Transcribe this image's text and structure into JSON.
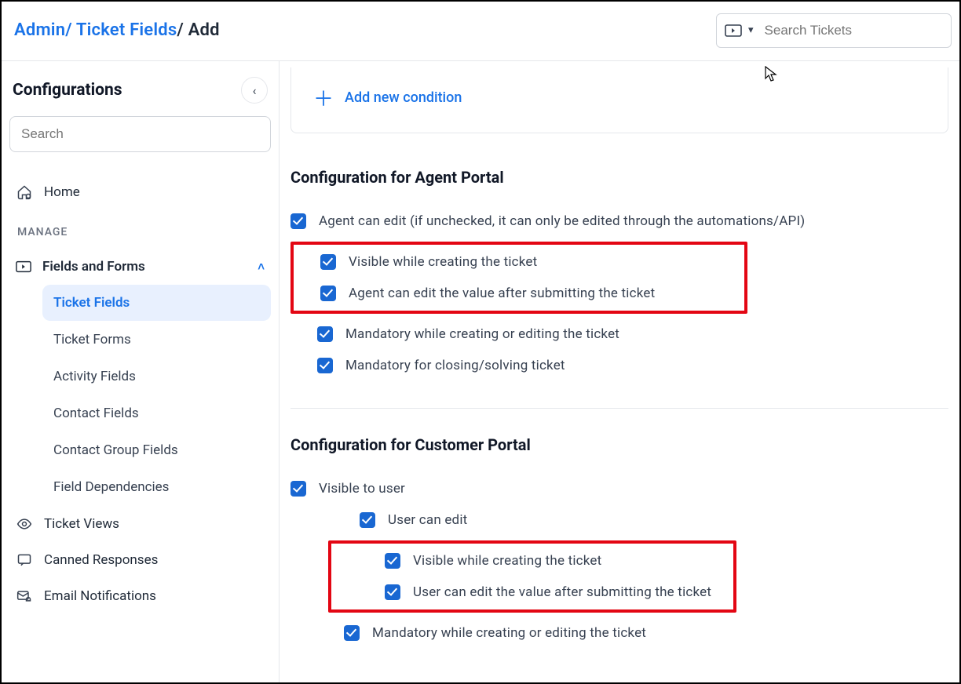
{
  "breadcrumb": {
    "admin": "Admin",
    "ticket_fields": "Ticket Fields",
    "add": "Add"
  },
  "search_tickets": {
    "placeholder": "Search Tickets"
  },
  "sidebar": {
    "title": "Configurations",
    "search_placeholder": "Search",
    "home": "Home",
    "manage_label": "MANAGE",
    "fields_and_forms": "Fields and Forms",
    "children": {
      "ticket_fields": "Ticket Fields",
      "ticket_forms": "Ticket Forms",
      "activity_fields": "Activity Fields",
      "contact_fields": "Contact Fields",
      "contact_group_fields": "Contact Group Fields",
      "field_dependencies": "Field Dependencies"
    },
    "ticket_views": "Ticket Views",
    "canned_responses": "Canned Responses",
    "email_notifications": "Email Notifications"
  },
  "main": {
    "add_condition": "Add new condition",
    "agent_header": "Configuration for Agent Portal",
    "agent": {
      "can_edit": "Agent can edit (if unchecked, it can only be edited through the automations/API)",
      "visible_creating": "Visible while creating the ticket",
      "agent_edit_after": "Agent can edit the value after submitting the ticket",
      "mandatory_create_edit": "Mandatory while creating or editing the ticket",
      "mandatory_closing": "Mandatory for closing/solving ticket"
    },
    "customer_header": "Configuration for Customer Portal",
    "customer": {
      "visible_to_user": "Visible to user",
      "user_can_edit": "User can edit",
      "visible_creating": "Visible while creating the ticket",
      "user_edit_after": "User can edit the value after submitting the ticket",
      "mandatory_create_edit": "Mandatory while creating or editing the ticket"
    }
  }
}
